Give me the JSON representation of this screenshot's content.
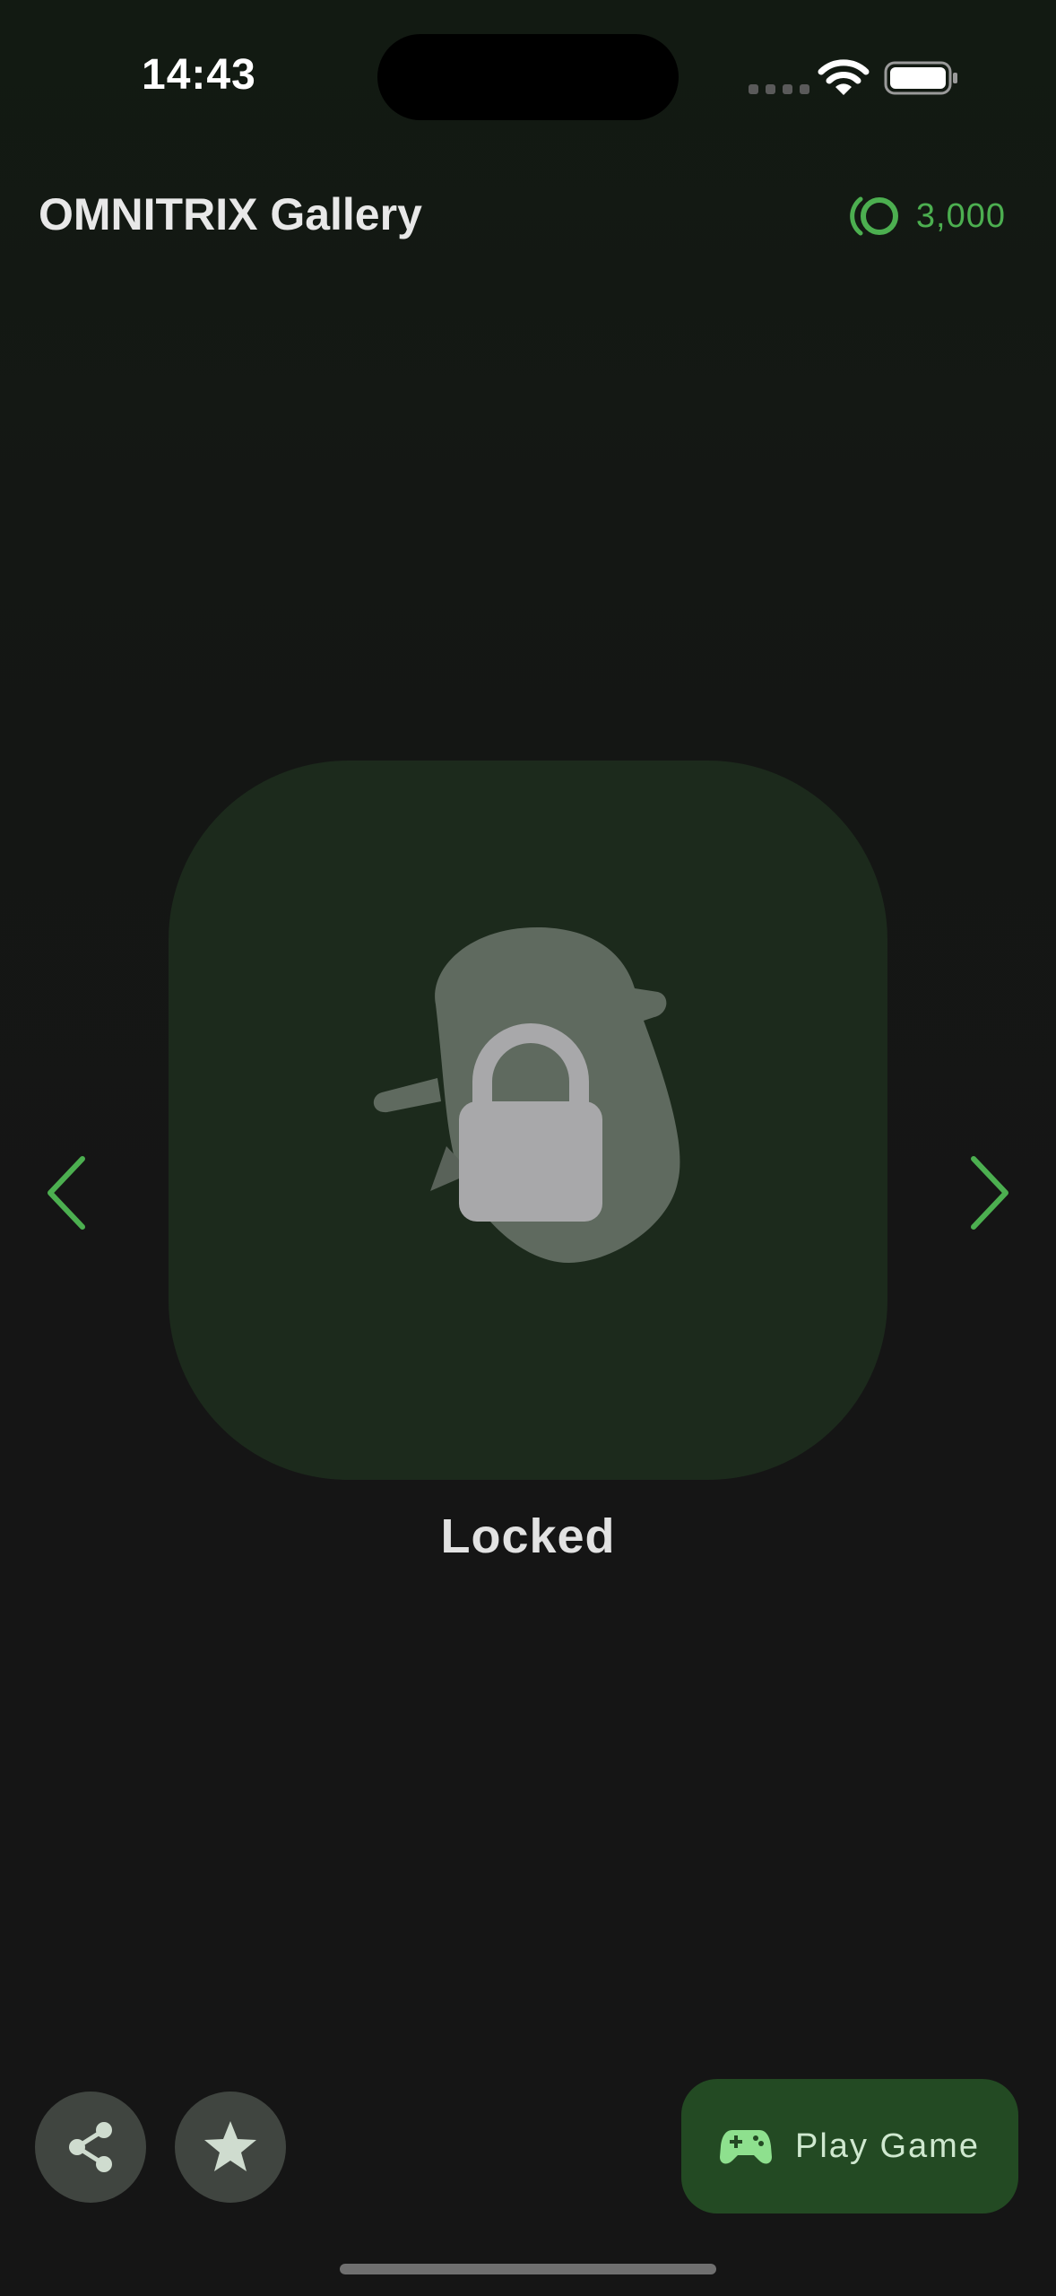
{
  "status_bar": {
    "time": "14:43",
    "wifi_icon": "wifi-icon",
    "battery_icon": "battery-full-icon"
  },
  "header": {
    "title": "OMNITRIX Gallery",
    "coin_icon": "omnitrix-coin-icon",
    "coins": "3,000"
  },
  "gallery": {
    "status": "Locked",
    "item_icon": "lock-icon",
    "prev_icon": "chevron-left-icon",
    "next_icon": "chevron-right-icon"
  },
  "actions": {
    "share_icon": "share-icon",
    "favorite_icon": "star-icon",
    "play_icon": "gamepad-icon",
    "play_label": "Play Game"
  },
  "colors": {
    "accent": "#4caf50",
    "card": "#1c2a1c",
    "play_button": "#234a23",
    "background": "#151515"
  }
}
